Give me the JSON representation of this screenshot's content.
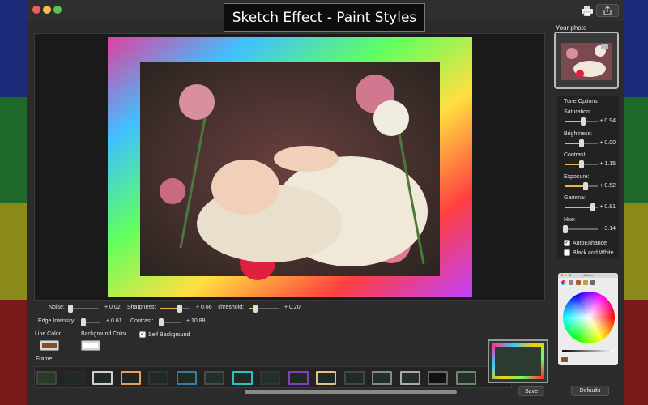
{
  "window": {
    "title": "Sketch Effect - Paint Styles",
    "icons": [
      "print-icon",
      "share-icon"
    ]
  },
  "sidebar": {
    "photo_title": "Your photo",
    "tune_title": "Tune Options",
    "options": [
      {
        "label": "Saturation:",
        "value": "+ 0.94",
        "level": 0.55
      },
      {
        "label": "Brightness:",
        "value": "+ 0.00",
        "level": 0.5
      },
      {
        "label": "Contrast:",
        "value": "+ 1.15",
        "level": 0.5
      },
      {
        "label": "Exposure:",
        "value": "+ 0.52",
        "level": 0.62
      },
      {
        "label": "Gamma:",
        "value": "+ 0.81",
        "level": 0.85
      },
      {
        "label": "Hue:",
        "value": "- 3.14",
        "level": 0.0
      }
    ],
    "auto_enhance": {
      "label": "AutoEnhance",
      "checked": true
    },
    "black_white": {
      "label": "Black and White",
      "checked": false
    },
    "color_panel_title": "Colors",
    "defaults_label": "Defaults"
  },
  "controls": {
    "noise": {
      "label": "Noise:",
      "value": "+ 0.02",
      "level": 0.05
    },
    "sharpness": {
      "label": "Sharpness:",
      "value": "+ 0.66",
      "level": 0.66
    },
    "threshold": {
      "label": "Threshold:",
      "value": "+ 0.20",
      "level": 0.2
    },
    "edge_intensity": {
      "label": "Edge Intensity:",
      "value": "+ 0.61",
      "level": 0.1
    },
    "contrast": {
      "label": "Contrast:",
      "value": "+ 10.88",
      "level": 0.1
    },
    "line_color_label": "Line Color",
    "background_color_label": "Background Color",
    "self_background": {
      "label": "Self Background",
      "checked": true
    },
    "frame_label": "Frame:",
    "save_label": "Save"
  },
  "colors": {
    "line_color": "#8b4a2a",
    "background_color": "#ffffff",
    "accent": "#e8b94a"
  },
  "frames": [
    {
      "color": "#2a3a2a",
      "border": "#444"
    },
    {
      "color": "#1e2a22",
      "border": "#2a2a2a"
    },
    {
      "color": "#1f2a24",
      "border": "#cfcfcf"
    },
    {
      "color": "#1f2420",
      "border": "#e0a060"
    },
    {
      "color": "#1f2a24",
      "border": "#2a3a30"
    },
    {
      "color": "#1f2a24",
      "border": "#3a7aa0"
    },
    {
      "color": "#23302a",
      "border": "#4a4a4a"
    },
    {
      "color": "#1f2a24",
      "border": "#30c0c0"
    },
    {
      "color": "#23302a",
      "border": "#2a3a30"
    },
    {
      "color": "#1f2a24",
      "border": "#8040c0"
    },
    {
      "color": "#1f2a24",
      "border": "#e0c090"
    },
    {
      "color": "#1f2a24",
      "border": "#404a44"
    },
    {
      "color": "#23302a",
      "border": "#888"
    },
    {
      "color": "#23302a",
      "border": "#aaaaaa"
    },
    {
      "color": "#111",
      "border": "#666"
    },
    {
      "color": "#23302a",
      "border": "#6a8a6a"
    }
  ]
}
